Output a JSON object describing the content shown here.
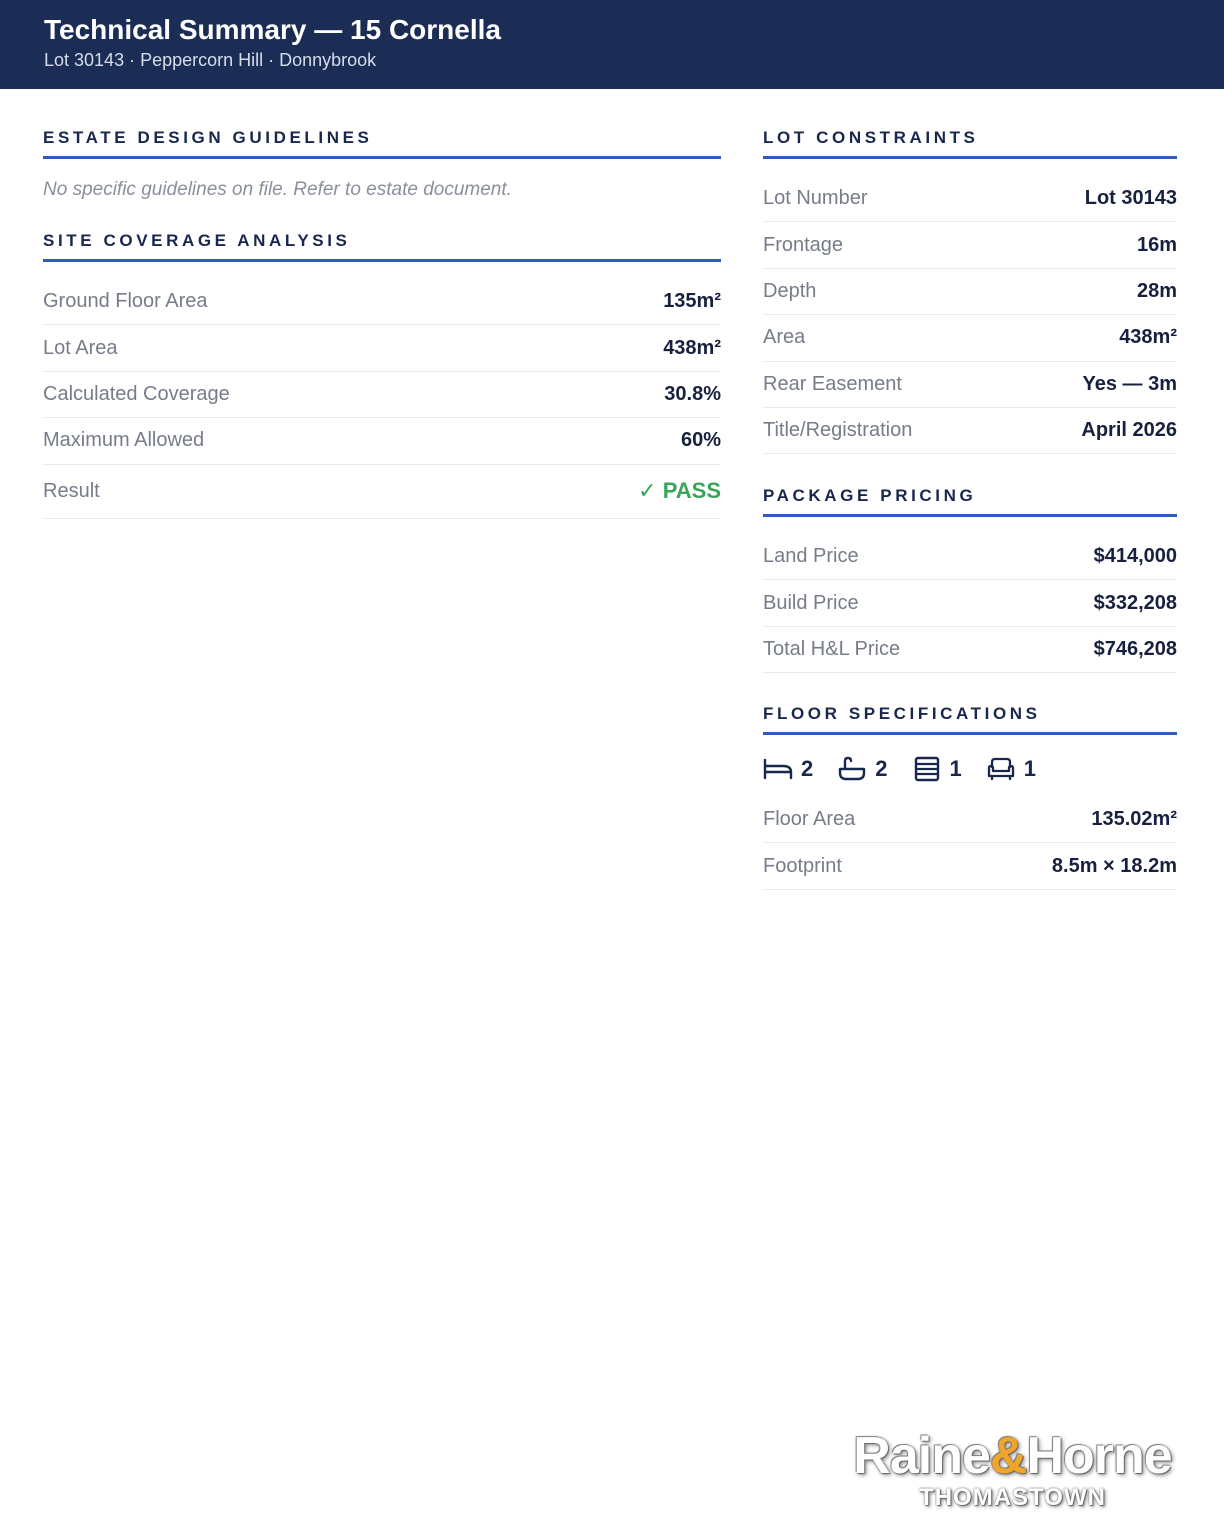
{
  "header": {
    "title": "Technical Summary — 15 Cornella",
    "subtitle": "Lot 30143 · Peppercorn Hill · Donnybrook"
  },
  "estate_guidelines": {
    "title": "ESTATE DESIGN GUIDELINES",
    "note": "No specific guidelines on file. Refer to estate document."
  },
  "site_coverage": {
    "title": "SITE COVERAGE ANALYSIS",
    "rows": [
      {
        "label": "Ground Floor Area",
        "value": "135m²"
      },
      {
        "label": "Lot Area",
        "value": "438m²"
      },
      {
        "label": "Calculated Coverage",
        "value": "30.8%"
      },
      {
        "label": "Maximum Allowed",
        "value": "60%"
      }
    ],
    "result_label": "Result",
    "result_value": "✓ PASS",
    "result_color": "#3aa55a"
  },
  "lot_constraints": {
    "title": "LOT CONSTRAINTS",
    "rows": [
      {
        "label": "Lot Number",
        "value": "Lot 30143"
      },
      {
        "label": "Frontage",
        "value": "16m"
      },
      {
        "label": "Depth",
        "value": "28m"
      },
      {
        "label": "Area",
        "value": "438m²"
      },
      {
        "label": "Rear Easement",
        "value": "Yes — 3m"
      },
      {
        "label": "Title/Registration",
        "value": "April 2026"
      }
    ]
  },
  "package_pricing": {
    "title": "PACKAGE PRICING",
    "rows": [
      {
        "label": "Land Price",
        "value": "$414,000"
      },
      {
        "label": "Build Price",
        "value": "$332,208"
      },
      {
        "label": "Total H&L Price",
        "value": "$746,208"
      }
    ]
  },
  "floor_specifications": {
    "title": "FLOOR SPECIFICATIONS",
    "features": [
      {
        "icon": "bed-icon",
        "count": "2"
      },
      {
        "icon": "bath-icon",
        "count": "2"
      },
      {
        "icon": "garage-icon",
        "count": "1"
      },
      {
        "icon": "living-icon",
        "count": "1"
      }
    ],
    "rows": [
      {
        "label": "Floor Area",
        "value": "135.02m²"
      },
      {
        "label": "Footprint",
        "value": "8.5m × 18.2m"
      }
    ]
  },
  "logo": {
    "name_part1": "Raine",
    "ampersand": "&",
    "name_part2": "Horne",
    "office": "THOMASTOWN"
  },
  "colors": {
    "header_bg": "#1b2c55",
    "accent_line": "#2f5bbd",
    "pass_green": "#3aa55a",
    "logo_orange": "#f0a42a"
  }
}
